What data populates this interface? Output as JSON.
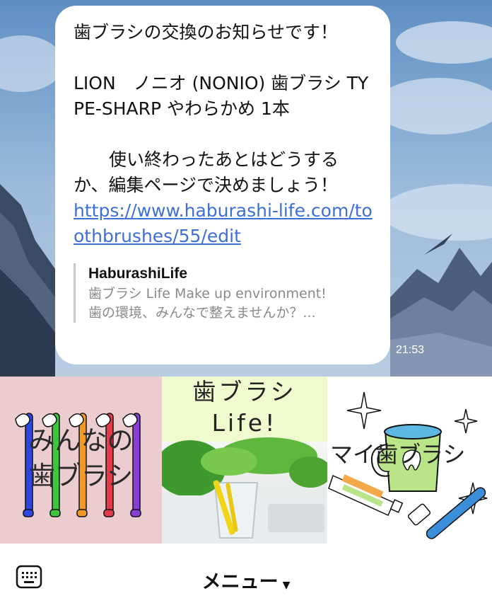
{
  "chat": {
    "message": {
      "text": "歯ブラシの交換のお知らせです！\n\nLION　ノニオ (NONIO) 歯ブラシ TYPE-SHARP やわらかめ 1本\n\n　　使い終わったあとはどうするか、編集ページで決めましょう！",
      "link": "https://www.haburashi-life.com/toothbrushes/55/edit",
      "preview": {
        "title": "HaburashiLife",
        "line1": "歯ブラシ Life Make up environment!",
        "line2": "歯の環境、みんなで整えませんか？..."
      },
      "time": "21:53"
    }
  },
  "rich_menu": {
    "tiles": [
      {
        "label": "みんなの\n歯ブラシ",
        "bg": "#ebcdd0",
        "icon": "colorful-toothbrushes"
      },
      {
        "label": "歯ブラシ\nLife!",
        "bg": "#eefbcf",
        "icon": "toothbrush-in-glass-photo"
      },
      {
        "label": "マイ歯ブラシ",
        "bg": "#ffffff",
        "icon": "mug-toothpaste-toothbrush"
      }
    ]
  },
  "bottom_bar": {
    "menu_label": "メニュー",
    "menu_caret": "▼",
    "keyboard_icon": "keyboard-icon"
  },
  "colors": {
    "link": "#3e6fd8",
    "preview_text": "#8a8a8a",
    "bubble": "#ffffff"
  }
}
